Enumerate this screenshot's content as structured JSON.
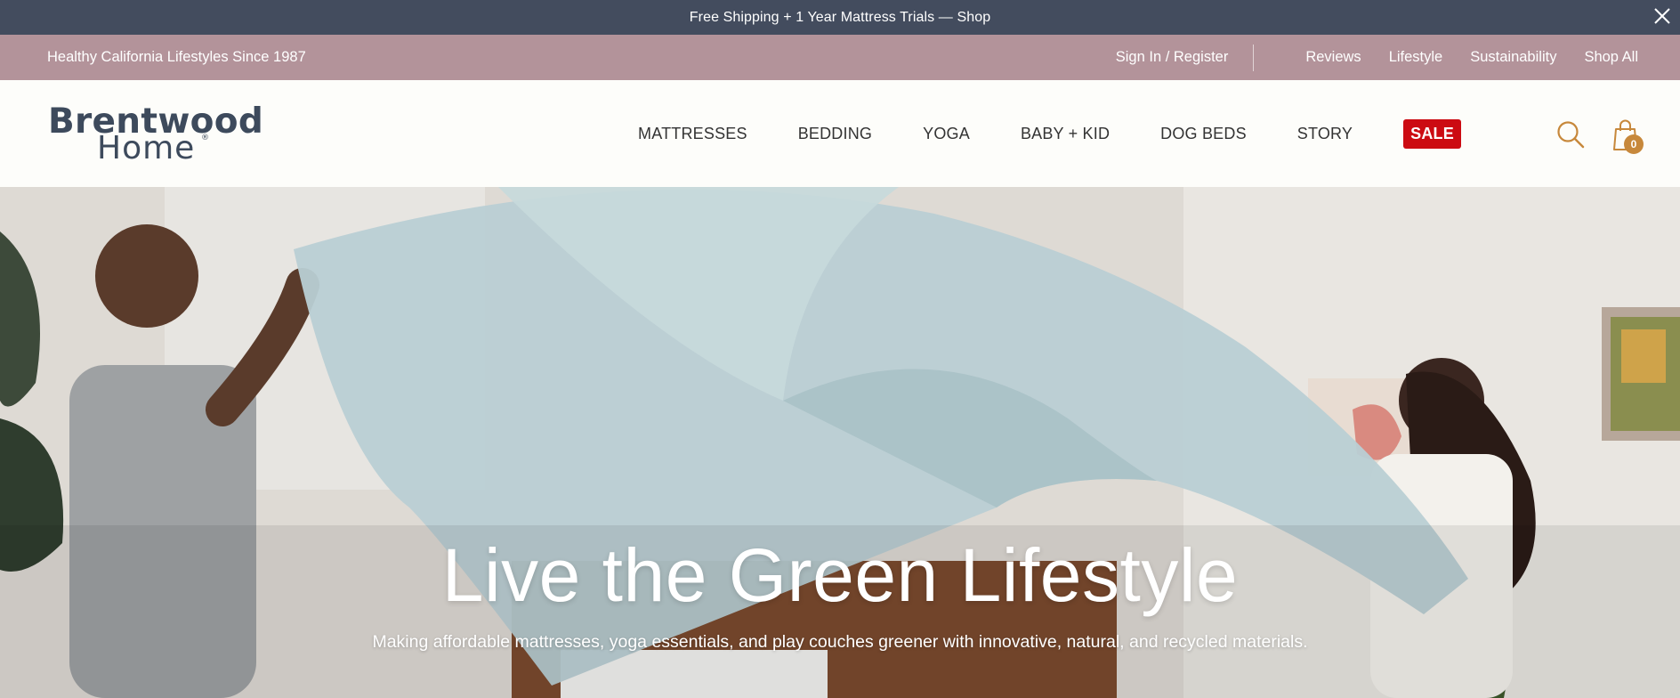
{
  "announcement": {
    "text": "Free Shipping + 1 Year Mattress Trials — Shop",
    "close_icon": "close-icon"
  },
  "utility_bar": {
    "tagline": "Healthy California Lifestyles Since 1987",
    "signin_label": "Sign In / Register",
    "links": [
      "Reviews",
      "Lifestyle",
      "Sustainability",
      "Shop All"
    ]
  },
  "header": {
    "logo_line1": "Brentwood",
    "logo_line2": "Home",
    "logo_mark": "®",
    "nav": [
      "MATTRESSES",
      "BEDDING",
      "YOGA",
      "BABY + KID",
      "DOG BEDS",
      "STORY"
    ],
    "sale_label": "SALE",
    "search_icon": "search-icon",
    "cart_icon": "shopping-bag-icon",
    "cart_count": "0"
  },
  "hero": {
    "title": "Live the Green Lifestyle",
    "subtitle": "Making affordable mattresses, yoga essentials, and play couches greener with innovative, natural, and recycled materials."
  },
  "colors": {
    "announcement_bg": "#434c5e",
    "utility_bg": "#b3939a",
    "sale_bg": "#cc0b12",
    "icon_accent": "#c7883b",
    "logo": "#3d4a5c"
  }
}
